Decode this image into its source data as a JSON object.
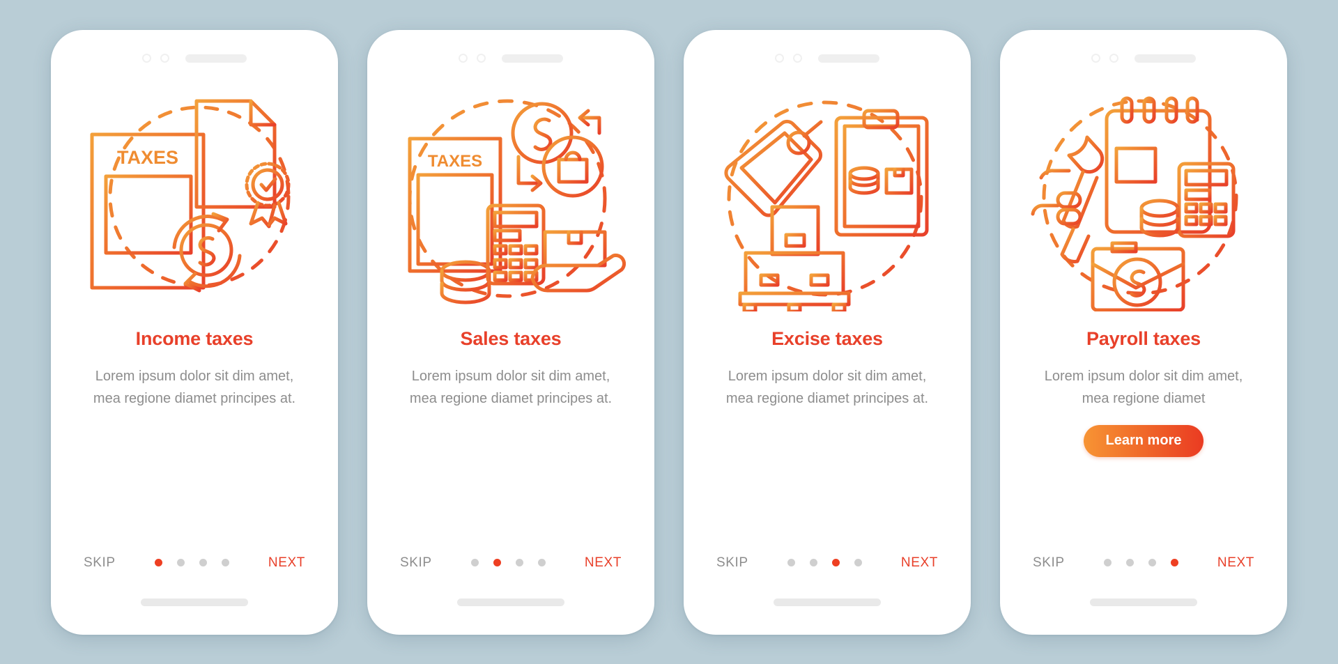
{
  "background_color": "#b9cdd6",
  "theme": {
    "accent_red": "#e8402a",
    "accent_orange": "#f0892f",
    "muted_text": "#8d8d8d",
    "dot_inactive": "#cfcfcf",
    "dot_active": "#ee3f22",
    "card_background": "#ffffff"
  },
  "screens": [
    {
      "title": "Income taxes",
      "body": "Lorem ipsum dolor sit dim amet, mea regione diamet principes at.",
      "illustration_label": "TAXES",
      "illustration_name": "income-taxes-illustration",
      "icons": [
        "tax-form-icon",
        "certificate-document-icon",
        "dollar-refresh-icon",
        "dashed-circle"
      ],
      "skip_label": "SKIP",
      "next_label": "NEXT",
      "active_dot": 1,
      "dot_count": 4,
      "has_cta": false,
      "cta_label": ""
    },
    {
      "title": "Sales taxes",
      "body": "Lorem ipsum dolor sit dim amet, mea regione diamet principes at.",
      "illustration_label": "TAXES",
      "illustration_name": "sales-taxes-illustration",
      "icons": [
        "tax-form-icon",
        "calculator-icon",
        "coins-icon",
        "dollar-coin-icon",
        "shopping-bag-icon",
        "package-in-hand-icon",
        "dashed-circle"
      ],
      "skip_label": "SKIP",
      "next_label": "NEXT",
      "active_dot": 2,
      "dot_count": 4,
      "has_cta": false,
      "cta_label": ""
    },
    {
      "title": "Excise taxes",
      "body": "Lorem ipsum dolor sit dim amet, mea regione diamet principes at.",
      "illustration_label": "",
      "illustration_name": "excise-taxes-illustration",
      "icons": [
        "price-tag-icon",
        "clipboard-icon",
        "coins-icon",
        "box-icon",
        "pallet-boxes-icon",
        "dashed-circle"
      ],
      "skip_label": "SKIP",
      "next_label": "NEXT",
      "active_dot": 3,
      "dot_count": 4,
      "has_cta": false,
      "cta_label": ""
    },
    {
      "title": "Payroll taxes",
      "body": "Lorem ipsum dolor sit dim amet, mea regione diamet",
      "illustration_label": "",
      "illustration_name": "payroll-taxes-illustration",
      "icons": [
        "wrench-in-hand-icon",
        "calendar-report-icon",
        "calculator-icon",
        "coins-icon",
        "briefcase-dollar-icon",
        "dashed-circle"
      ],
      "skip_label": "SKIP",
      "next_label": "NEXT",
      "active_dot": 4,
      "dot_count": 4,
      "has_cta": true,
      "cta_label": "Learn more"
    }
  ]
}
